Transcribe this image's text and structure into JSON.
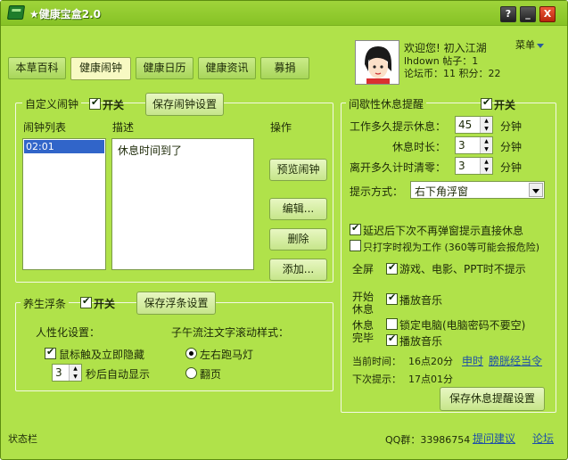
{
  "window": {
    "title": "健康宝盒2.0",
    "controls": [
      "?",
      "_",
      "X"
    ]
  },
  "tabs": [
    {
      "label": "本草百科",
      "active": false
    },
    {
      "label": "健康闹钟",
      "active": true
    },
    {
      "label": "健康日历",
      "active": false
    },
    {
      "label": "健康资讯",
      "active": false
    },
    {
      "label": "募捐",
      "active": false
    }
  ],
  "profile": {
    "greeting": "欢迎您! 初入江湖",
    "username": "lhdown",
    "posts_label": "帖子：1",
    "coins_label": "论坛币：11 积分：22",
    "menu_label": "菜单"
  },
  "custom_alarm": {
    "title": "自定义闹钟",
    "toggle_label": "开关",
    "save_button": "保存闹钟设置",
    "list_header": "闹钟列表",
    "desc_header": "描述",
    "action_header": "操作",
    "alarms": [
      "02:01"
    ],
    "description": "休息时间到了",
    "preview_button": "预览闹钟",
    "edit_button": "编辑...",
    "delete_button": "删除",
    "add_button": "添加..."
  },
  "health_ticker": {
    "title": "养生浮条",
    "toggle_label": "开关",
    "save_button": "保存浮条设置",
    "personalize_label": "人性化设置：",
    "hide_on_touch": "鼠标触及立即隐藏",
    "auto_show_value": "3",
    "auto_show_suffix": "秒后自动显示",
    "scroll_style_label": "子午流注文字滚动样式：",
    "style_options": [
      "左右跑马灯",
      "翻页"
    ],
    "style_selected": "左右跑马灯"
  },
  "rest_reminder": {
    "title": "间歇性休息提醒",
    "toggle_label": "开关",
    "work_label": "工作多久提示休息：",
    "work_value": "45",
    "rest_label": "休息时长：",
    "rest_value": "3",
    "leave_label": "离开多久计时清零：",
    "leave_value": "3",
    "unit": "分钟",
    "method_label": "提示方式：",
    "method_value": "右下角浮窗",
    "delay_option": "延迟后下次不再弹窗提示直接休息",
    "typing_option": "只打字时视为工作 (360等可能会报危险)",
    "fullscreen_label": "全屏",
    "fullscreen_option": "游戏、电影、PPT时不提示",
    "start_label_1": "开始",
    "start_label_2": "休息",
    "start_option": "播放音乐",
    "end_label_1": "休息",
    "end_label_2": "完毕",
    "lock_option": "锁定电脑(电脑密码不要空)",
    "end_option": "播放音乐",
    "current_time_label": "当前时间：",
    "current_time_value": "16点20分",
    "current_shichen": "申时",
    "current_organ": "膀胱经当令",
    "next_label": "下次提示：",
    "next_value": "17点01分",
    "save_button": "保存休息提醒设置"
  },
  "status_bar": {
    "text": "状态栏",
    "qq_group": "QQ群：33986754",
    "feedback_link": "提问建议",
    "forum_link": "论坛"
  },
  "colors": {
    "window_bg": "#b0e24a",
    "titlebar": "#8fc92c",
    "link": "#1e4fa8",
    "tab_active": "#f7f9c2"
  }
}
